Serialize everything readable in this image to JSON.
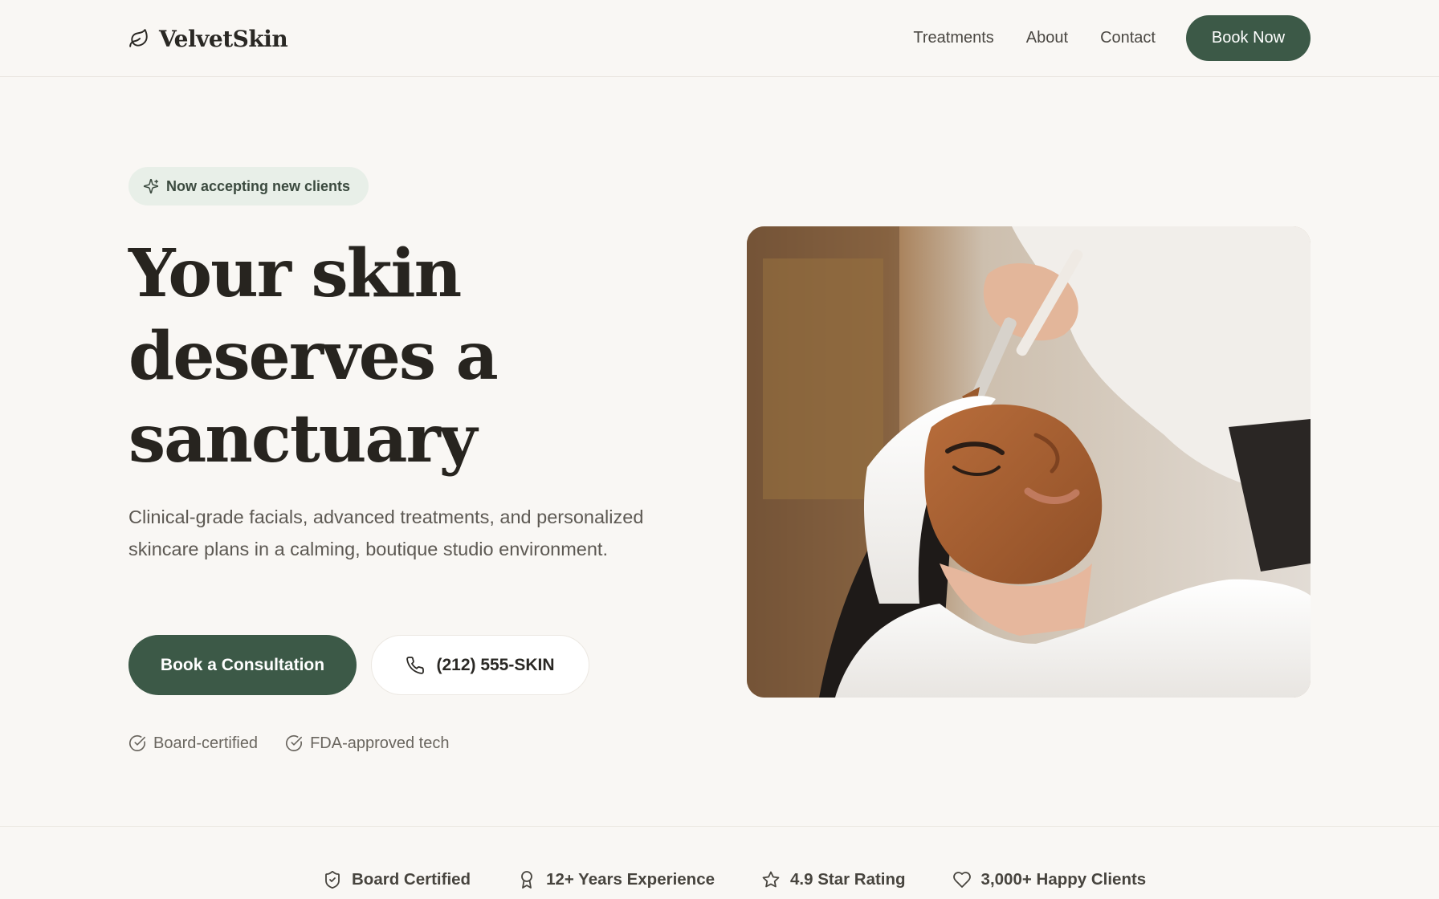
{
  "brand": {
    "name": "VelvetSkin",
    "logo_icon": "leaf-icon"
  },
  "nav": {
    "links": [
      "Treatments",
      "About",
      "Contact"
    ],
    "cta_label": "Book Now"
  },
  "hero": {
    "badge": {
      "icon": "sparkle-icon",
      "text": "Now accepting new clients"
    },
    "title_lines": [
      "Your skin",
      "deserves a",
      "sanctuary"
    ],
    "subtitle": "Clinical-grade facials, advanced treatments, and personalized skincare plans in a calming, boutique studio environment.",
    "primary_cta": "Book a Consultation",
    "phone": {
      "icon": "phone-icon",
      "label": "(212) 555-SKIN"
    },
    "checks": [
      {
        "icon": "check-circle-icon",
        "label": "Board-certified"
      },
      {
        "icon": "check-circle-icon",
        "label": "FDA-approved tech"
      }
    ],
    "image_alt": "Esthetician applying a facial mask with a brush"
  },
  "stats": [
    {
      "icon": "shield-icon",
      "label": "Board Certified"
    },
    {
      "icon": "award-icon",
      "label": "12+ Years Experience"
    },
    {
      "icon": "star-icon",
      "label": "4.9 Star Rating"
    },
    {
      "icon": "heart-icon",
      "label": "3,000+ Happy Clients"
    }
  ],
  "colors": {
    "background": "#f9f7f4",
    "accent": "#3c5947",
    "badge_bg": "#e8efe8",
    "heading": "#27241f",
    "body_text": "#5d5953"
  }
}
